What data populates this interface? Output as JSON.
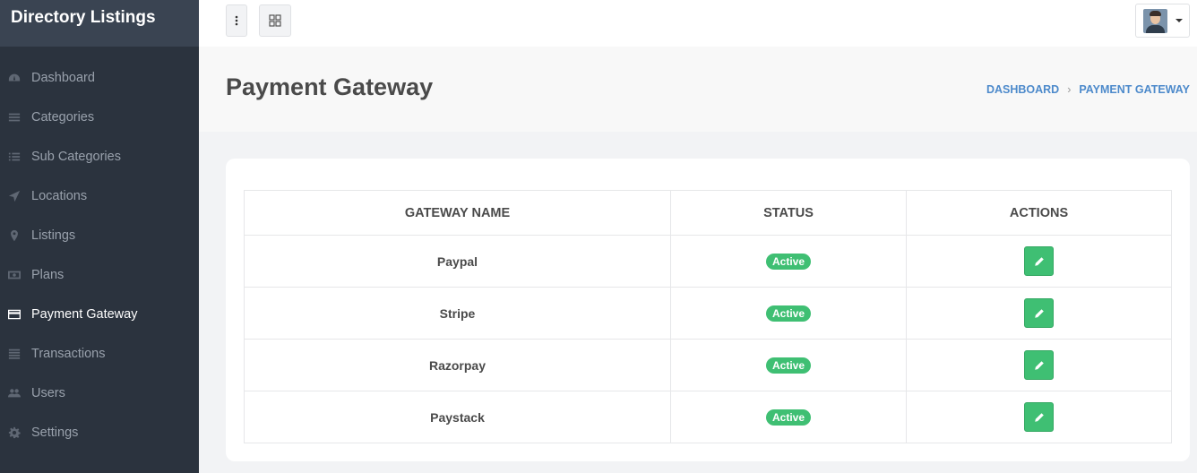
{
  "sidebar": {
    "brand": "Directory Listings",
    "items": [
      {
        "label": "Dashboard",
        "icon": "dashboard-icon"
      },
      {
        "label": "Categories",
        "icon": "list-icon"
      },
      {
        "label": "Sub Categories",
        "icon": "list-ul-icon"
      },
      {
        "label": "Locations",
        "icon": "location-arrow-icon"
      },
      {
        "label": "Listings",
        "icon": "map-marker-icon"
      },
      {
        "label": "Plans",
        "icon": "money-icon"
      },
      {
        "label": "Payment Gateway",
        "icon": "credit-card-icon",
        "active": true
      },
      {
        "label": "Transactions",
        "icon": "list-alt-icon"
      },
      {
        "label": "Users",
        "icon": "users-icon"
      },
      {
        "label": "Settings",
        "icon": "gear-icon"
      }
    ]
  },
  "topbar": {
    "menu_icon": "kebab-icon",
    "grid_icon": "grid-icon",
    "user_icon": "avatar"
  },
  "page": {
    "title": "Payment Gateway",
    "breadcrumb": [
      "DASHBOARD",
      "PAYMENT GATEWAY"
    ]
  },
  "table": {
    "headers": [
      "GATEWAY NAME",
      "STATUS",
      "ACTIONS"
    ],
    "rows": [
      {
        "name": "Paypal",
        "status": "Active"
      },
      {
        "name": "Stripe",
        "status": "Active"
      },
      {
        "name": "Razorpay",
        "status": "Active"
      },
      {
        "name": "Paystack",
        "status": "Active"
      }
    ]
  },
  "colors": {
    "sidebar_bg": "#2b333e",
    "accent_green": "#3fbf73",
    "link_blue": "#4d8acb"
  }
}
